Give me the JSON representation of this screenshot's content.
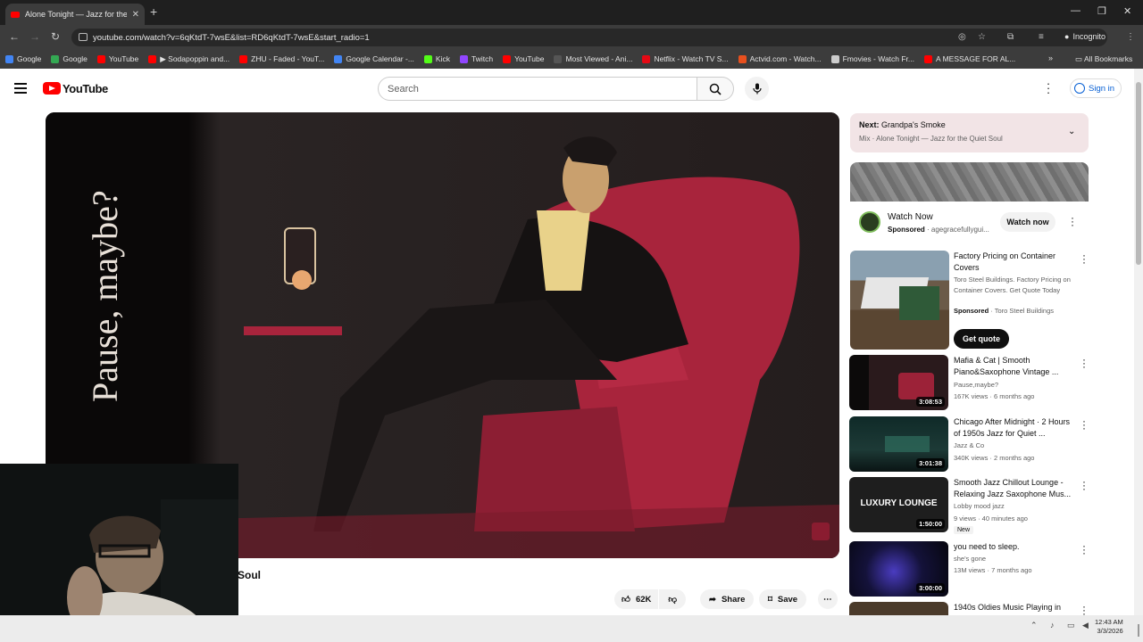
{
  "browser": {
    "tab_title": "Alone Tonight — Jazz for the Q",
    "url": "youtube.com/watch?v=6qKtdT-7wsE&list=RD6qKtdT-7wsE&start_radio=1",
    "incognito_label": "Incognito",
    "all_bookmarks": "All Bookmarks",
    "bookmarks": [
      {
        "label": "Google",
        "color": "#4285f4"
      },
      {
        "label": "Google",
        "color": "#34a853"
      },
      {
        "label": "YouTube",
        "color": "#ff0000"
      },
      {
        "label": "▶ Sodapoppin and...",
        "color": "#ff0000"
      },
      {
        "label": "ZHU - Faded - YouT...",
        "color": "#ff0000"
      },
      {
        "label": "Google Calendar -...",
        "color": "#4285f4"
      },
      {
        "label": "Kick",
        "color": "#53fc18"
      },
      {
        "label": "Twitch",
        "color": "#9146ff"
      },
      {
        "label": "YouTube",
        "color": "#ff0000"
      },
      {
        "label": "Most Viewed - Ani...",
        "color": "#555555"
      },
      {
        "label": "Netflix - Watch TV S...",
        "color": "#e50914"
      },
      {
        "label": "Actvid.com - Watch...",
        "color": "#e8501e"
      },
      {
        "label": "Fmovies - Watch Fr...",
        "color": "#cccccc"
      },
      {
        "label": "A MESSAGE FOR AL...",
        "color": "#ff0000"
      }
    ]
  },
  "youtube": {
    "logo_text": "YouTube",
    "search_placeholder": "Search",
    "sign_in": "Sign in"
  },
  "video": {
    "overlay_text": "Pause, maybe?",
    "title_fragment": "Soul",
    "likes": "62K",
    "share": "Share",
    "save": "Save"
  },
  "sidebar": {
    "next_label": "Next:",
    "next_title": "Grandpa's Smoke",
    "next_sub": "Mix · Alone Tonight — Jazz for the Quiet Soul",
    "ad": {
      "title": "Watch Now",
      "sponsored": "Sponsored",
      "domain": "agegracefullygui...",
      "button": "Watch now"
    },
    "promo": {
      "title": "Factory Pricing on Container Covers",
      "desc": "Toro Steel Buildings. Factory Pricing on Container Covers. Get Quote Today",
      "sponsored": "Sponsored",
      "advertiser": "Toro Steel Buildings",
      "button": "Get quote"
    },
    "videos": [
      {
        "title": "Mafia & Cat | Smooth Piano&Saxophone Vintage ...",
        "channel": "Pause,maybe?",
        "meta": "167K views · 6 months ago",
        "duration": "3:08:53",
        "thumb": "#2a1a1c"
      },
      {
        "title": "Chicago After Midnight · 2 Hours of 1950s Jazz for Quiet ...",
        "channel": "Jazz & Co",
        "meta": "340K views · 2 months ago",
        "duration": "3:01:38",
        "thumb": "#1d3a36"
      },
      {
        "title": "Smooth Jazz Chillout Lounge - Relaxing Jazz Saxophone Mus...",
        "channel": "Lobby mood jazz",
        "meta": "9 views · 40 minutes ago",
        "duration": "1:50:00",
        "thumb": "#2b2b2b",
        "overlay": "LUXURY LOUNGE",
        "badge": "New"
      },
      {
        "title": "you need to sleep.",
        "channel": "she's gone",
        "meta": "13M views · 7 months ago",
        "duration": "3:00:00",
        "thumb": "#14123a"
      },
      {
        "title": "1940s Oldies Music Playing in",
        "channel": "",
        "meta": "",
        "duration": "",
        "thumb": "#4a3a2a"
      }
    ]
  },
  "taskbar": {
    "time": "12:43 AM",
    "date": "3/3/2026"
  }
}
